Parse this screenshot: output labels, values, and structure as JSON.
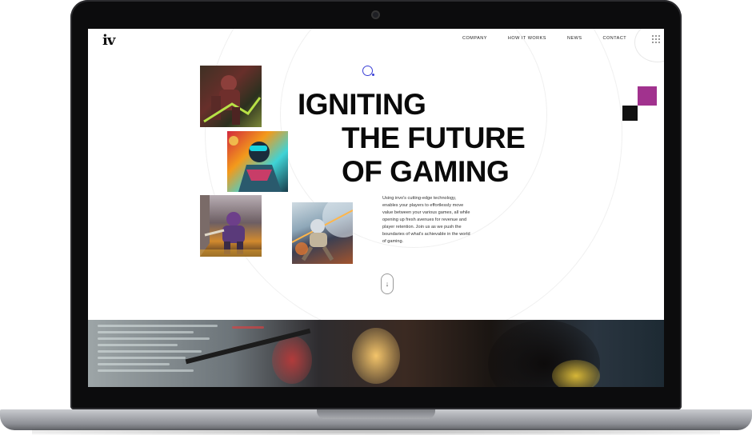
{
  "site": {
    "logo": "iv",
    "nav": [
      {
        "label": "COMPANY"
      },
      {
        "label": "HOW IT WORKS"
      },
      {
        "label": "NEWS"
      },
      {
        "label": "CONTACT"
      }
    ],
    "menu_icon": "grid-dots-icon"
  },
  "hero": {
    "headline": [
      "IGNITING",
      "THE FUTURE",
      "OF GAMING"
    ],
    "description": "Using invo's cutting-edge technology, enables your players to effortlessly move value between your various games, all while opening up fresh avenues for revenue and player retention. Join us as we push the boundaries of what's achievable in the world of gaming.",
    "scroll_icon": "arrow-down-icon",
    "accent_color": "#3a3fd6",
    "square_colors": [
      "#a1328e",
      "#111111"
    ]
  },
  "images": [
    {
      "name": "game-art-armored-soldier"
    },
    {
      "name": "game-art-neon-warrior"
    },
    {
      "name": "game-art-knight"
    },
    {
      "name": "game-art-space-explorer"
    }
  ],
  "photo_strip": {
    "name": "gamer-streaming-photo"
  }
}
